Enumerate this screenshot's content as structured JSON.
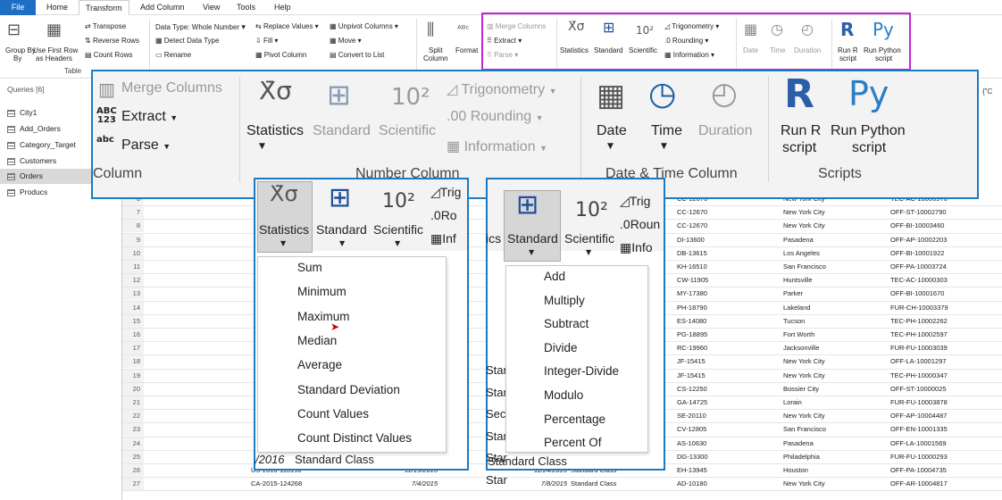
{
  "menubar": {
    "tabs": [
      "File",
      "Home",
      "Transform",
      "Add Column",
      "View",
      "Tools",
      "Help"
    ]
  },
  "ribbon": {
    "group_by": "Group By",
    "group_by2": "By",
    "use_first_row": "Use First Row",
    "as_headers": "as Headers",
    "table_label": "Table",
    "transpose": "Transpose",
    "reverse_rows": "Reverse Rows",
    "count_rows": "Count Rows",
    "data_type": "Data Type: Whole Number",
    "detect_data_type": "Detect Data Type",
    "rename": "Rename",
    "replace_values": "Replace Values",
    "fill": "Fill",
    "pivot_column": "Pivot Column",
    "unpivot_columns": "Unpivot Columns",
    "move": "Move",
    "convert_to_list": "Convert to List",
    "split_column": "Split",
    "split_column2": "Column",
    "format": "Format",
    "merge_columns": "Merge Columns",
    "extract": "Extract",
    "parse": "Parse",
    "statistics": "Statistics",
    "standard": "Standard",
    "scientific": "Scientific",
    "trigonometry": "Trigonometry",
    "rounding": "Rounding",
    "information": "Information",
    "date": "Date",
    "time": "Time",
    "duration": "Duration",
    "run_r": "Run R",
    "run_r2": "script",
    "run_py": "Run Python",
    "run_py2": "script"
  },
  "queries": {
    "title": "Queries [6]",
    "items": [
      "City1",
      "Add_Orders",
      "Category_Target",
      "Customers",
      "Orders",
      "Producs"
    ],
    "selected": "Orders"
  },
  "zoom": {
    "merge_columns": "Merge Columns",
    "extract": "Extract",
    "parse": "Parse",
    "column_label": "Column",
    "statistics": "Statistics",
    "standard": "Standard",
    "scientific": "Scientific",
    "trigonometry": "Trigonometry",
    "rounding": "Rounding",
    "information": "Information",
    "number_column_label": "Number Column",
    "date": "Date",
    "time": "Time",
    "duration": "Duration",
    "date_time_label": "Date & Time Column",
    "run_r": "Run R",
    "run_r2": "script",
    "run_py": "Run Python",
    "run_py2": "script",
    "scripts_label": "Scripts",
    "abc": "ABC",
    "n123": "123",
    "abc2": "abc"
  },
  "statistics_panel": {
    "statistics": "Statistics",
    "standard": "Standard",
    "scientific": "Scientific",
    "trig": "Trig",
    "ro": "Ro",
    "inf": "Inf",
    "items": [
      "Sum",
      "Minimum",
      "Maximum",
      "Median",
      "Average",
      "Standard Deviation",
      "Count Values",
      "Count Distinct Values"
    ],
    "peek_date": "/2016",
    "peek_class": "Standard Class"
  },
  "standard_panel": {
    "standard": "Standard",
    "scientific": "Scientific",
    "trig": "Trig",
    "roun": "Roun",
    "info": "Info",
    "ics": "ics",
    "items": [
      "Add",
      "Multiply",
      "Subtract",
      "Divide",
      "Integer-Divide",
      "Modulo",
      "Percentage",
      "Percent Of"
    ],
    "peek_class": "Standard Class",
    "left_peek": [
      "Star",
      "Star",
      "Sec",
      "Star",
      "Star",
      "Star"
    ]
  },
  "grid": {
    "rows": [
      {
        "n": "6",
        "cust": "CC-12670",
        "city": "New York City",
        "prod": "TEC-AC-10000976"
      },
      {
        "n": "7",
        "cust": "CC-12670",
        "city": "New York City",
        "prod": "OFF-ST-10002790"
      },
      {
        "n": "8",
        "cust": "CC-12670",
        "city": "New York City",
        "prod": "OFF-BI-10003460"
      },
      {
        "n": "9",
        "cust": "DI-13600",
        "city": "Pasadena",
        "prod": "OFF-AP-10002203"
      },
      {
        "n": "10",
        "cust": "DB-13615",
        "city": "Los Angeles",
        "prod": "OFF-BI-10001922"
      },
      {
        "n": "11",
        "cust": "KH-16510",
        "city": "San Francisco",
        "prod": "OFF-PA-10003724"
      },
      {
        "n": "12",
        "cust": "CW-11905",
        "city": "Huntsville",
        "prod": "TEC-AC-10000303"
      },
      {
        "n": "13",
        "cust": "MY-17380",
        "city": "Parker",
        "prod": "OFF-BI-10001670"
      },
      {
        "n": "14",
        "cust": "PH-18790",
        "city": "Lakeland",
        "prod": "FUR-CH-10003379"
      },
      {
        "n": "15",
        "cust": "ES-14080",
        "city": "Tucson",
        "prod": "TEC-PH-10002262"
      },
      {
        "n": "16",
        "cust": "PG-18895",
        "city": "Fort Worth",
        "prod": "TEC-PH-10002597"
      },
      {
        "n": "17",
        "cust": "RC-19960",
        "city": "Jacksonville",
        "prod": "FUR-FU-10003039"
      },
      {
        "n": "18",
        "cust": "JF-15415",
        "city": "New York City",
        "prod": "OFF-LA-10001297"
      },
      {
        "n": "19",
        "cust": "JF-15415",
        "city": "New York City",
        "prod": "TEC-PH-10000347"
      },
      {
        "n": "20",
        "cust": "CS-12250",
        "city": "Bossier City",
        "prod": "OFF-ST-10000025"
      },
      {
        "n": "21",
        "cust": "GA-14725",
        "city": "Lorain",
        "prod": "FUR-FU-10003878"
      },
      {
        "n": "22",
        "cust": "SE-20110",
        "city": "New York City",
        "prod": "OFF-AP-10004487"
      },
      {
        "n": "23",
        "cust": "CV-12805",
        "city": "San Francisco",
        "prod": "OFF-EN-10001335"
      },
      {
        "n": "24",
        "cust": "AS-10630",
        "city": "Pasadena",
        "prod": "OFF-LA-10001569"
      },
      {
        "n": "25",
        "cust": "DG-13300",
        "city": "Philadelphia",
        "prod": "FUR-FU-10000293"
      },
      {
        "n": "26",
        "order": "US-2016-110156",
        "od": "11/19/2016",
        "sd": "11/24/2016",
        "ship": "Standard Class",
        "cust": "EH-13945",
        "city": "Houston",
        "prod": "OFF-PA-10004735"
      },
      {
        "n": "27",
        "order": "CA-2015-124268",
        "od": "7/4/2015",
        "sd": "7/8/2015",
        "ship": "Standard Class",
        "cust": "AD-10180",
        "city": "New York City",
        "prod": "OFF-AR-10004817"
      }
    ],
    "formula_peek": "{\"C",
    "col_peek": "ABC\n123",
    "col_peek2": "A\n1"
  }
}
